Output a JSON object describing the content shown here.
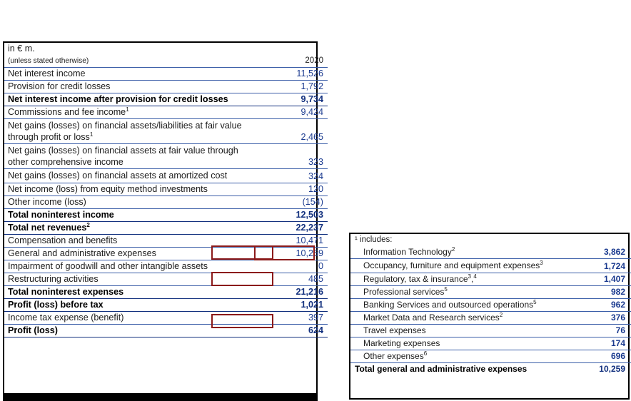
{
  "income_statement": {
    "unit_label": "in € m.",
    "subheader_label": "(unless stated otherwise)",
    "period": "2020",
    "rows": [
      {
        "label": "Net interest income",
        "value": "11,526",
        "style": "normal"
      },
      {
        "label": "Provision for credit losses",
        "value": "1,792",
        "style": "normal"
      },
      {
        "label": "Net interest income after provision for credit losses",
        "value": "9,734",
        "style": "bold"
      },
      {
        "label": "Commissions and fee income¹",
        "value": "9,424",
        "style": "normal"
      },
      {
        "label": "Net gains (losses) on financial assets/liabilities at fair value through profit or loss¹",
        "value": "2,465",
        "style": "two-line"
      },
      {
        "label": "Net gains (losses) on financial assets at fair value through other comprehensive income",
        "value": "323",
        "style": "two-line"
      },
      {
        "label": "Net gains (losses) on financial assets at amortized cost",
        "value": "324",
        "style": "two-line"
      },
      {
        "label": "Net income (loss) from equity method investments",
        "value": "120",
        "style": "normal"
      },
      {
        "label": "Other income (loss)",
        "value": "(154)",
        "style": "normal"
      },
      {
        "label": "Total noninterest income",
        "value": "12,503",
        "style": "bold"
      },
      {
        "label": "Total net revenues²",
        "value": "22,237",
        "style": "bold"
      },
      {
        "label": "Compensation and benefits",
        "value": "10,471",
        "style": "normal"
      },
      {
        "label": "General and administrative expenses",
        "value": "10,259",
        "style": "normal"
      },
      {
        "label": "Impairment of goodwill and other intangible assets",
        "value": "0",
        "style": "normal"
      },
      {
        "label": "Restructuring activities",
        "value": "485",
        "style": "normal"
      },
      {
        "label": "Total noninterest expenses",
        "value": "21,216",
        "style": "bold"
      },
      {
        "label": "Profit (loss) before tax",
        "value": "1,021",
        "style": "bold"
      },
      {
        "label": "Income tax expense (benefit)",
        "value": "397",
        "style": "normal"
      },
      {
        "label": "Profit (loss)",
        "value": "624",
        "style": "bold"
      }
    ]
  },
  "breakdown": {
    "header": "¹ includes:",
    "rows": [
      {
        "label": "Information Technology²",
        "value": "3,862"
      },
      {
        "label": "Occupancy, furniture and equipment expenses³",
        "value": "1,724"
      },
      {
        "label": "Regulatory, tax & insurance³,⁴",
        "value": "1,407"
      },
      {
        "label": "Professional services⁵",
        "value": "982"
      },
      {
        "label": "Banking Services and outsourced operations⁵",
        "value": "962"
      },
      {
        "label": "Market Data and Research services²",
        "value": "376"
      },
      {
        "label": "Travel expenses",
        "value": "76"
      },
      {
        "label": "Marketing expenses",
        "value": "174"
      },
      {
        "label": "Other expenses⁶",
        "value": "696"
      }
    ],
    "total_label": "Total general and administrative expenses",
    "total_value": "10,259"
  },
  "highlights": {
    "accent_color": "#8b1a1a",
    "value_color": "#1a3a8f"
  }
}
